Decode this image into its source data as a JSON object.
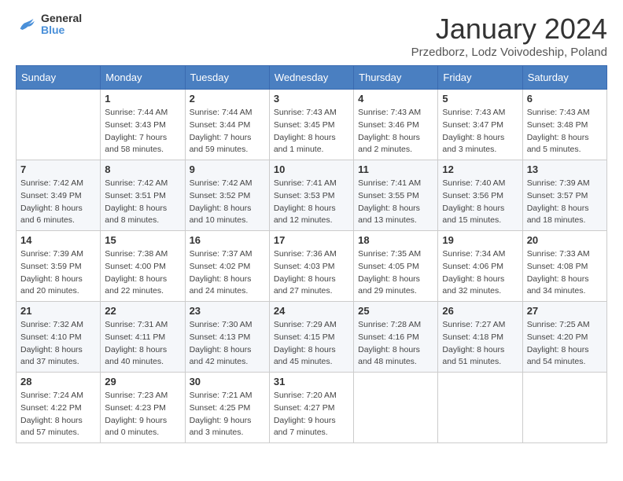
{
  "header": {
    "logo_general": "General",
    "logo_blue": "Blue",
    "month_title": "January 2024",
    "location": "Przedborz, Lodz Voivodeship, Poland"
  },
  "weekdays": [
    "Sunday",
    "Monday",
    "Tuesday",
    "Wednesday",
    "Thursday",
    "Friday",
    "Saturday"
  ],
  "weeks": [
    [
      {
        "day": "",
        "sunrise": "",
        "sunset": "",
        "daylight": ""
      },
      {
        "day": "1",
        "sunrise": "Sunrise: 7:44 AM",
        "sunset": "Sunset: 3:43 PM",
        "daylight": "Daylight: 7 hours and 58 minutes."
      },
      {
        "day": "2",
        "sunrise": "Sunrise: 7:44 AM",
        "sunset": "Sunset: 3:44 PM",
        "daylight": "Daylight: 7 hours and 59 minutes."
      },
      {
        "day": "3",
        "sunrise": "Sunrise: 7:43 AM",
        "sunset": "Sunset: 3:45 PM",
        "daylight": "Daylight: 8 hours and 1 minute."
      },
      {
        "day": "4",
        "sunrise": "Sunrise: 7:43 AM",
        "sunset": "Sunset: 3:46 PM",
        "daylight": "Daylight: 8 hours and 2 minutes."
      },
      {
        "day": "5",
        "sunrise": "Sunrise: 7:43 AM",
        "sunset": "Sunset: 3:47 PM",
        "daylight": "Daylight: 8 hours and 3 minutes."
      },
      {
        "day": "6",
        "sunrise": "Sunrise: 7:43 AM",
        "sunset": "Sunset: 3:48 PM",
        "daylight": "Daylight: 8 hours and 5 minutes."
      }
    ],
    [
      {
        "day": "7",
        "sunrise": "Sunrise: 7:42 AM",
        "sunset": "Sunset: 3:49 PM",
        "daylight": "Daylight: 8 hours and 6 minutes."
      },
      {
        "day": "8",
        "sunrise": "Sunrise: 7:42 AM",
        "sunset": "Sunset: 3:51 PM",
        "daylight": "Daylight: 8 hours and 8 minutes."
      },
      {
        "day": "9",
        "sunrise": "Sunrise: 7:42 AM",
        "sunset": "Sunset: 3:52 PM",
        "daylight": "Daylight: 8 hours and 10 minutes."
      },
      {
        "day": "10",
        "sunrise": "Sunrise: 7:41 AM",
        "sunset": "Sunset: 3:53 PM",
        "daylight": "Daylight: 8 hours and 12 minutes."
      },
      {
        "day": "11",
        "sunrise": "Sunrise: 7:41 AM",
        "sunset": "Sunset: 3:55 PM",
        "daylight": "Daylight: 8 hours and 13 minutes."
      },
      {
        "day": "12",
        "sunrise": "Sunrise: 7:40 AM",
        "sunset": "Sunset: 3:56 PM",
        "daylight": "Daylight: 8 hours and 15 minutes."
      },
      {
        "day": "13",
        "sunrise": "Sunrise: 7:39 AM",
        "sunset": "Sunset: 3:57 PM",
        "daylight": "Daylight: 8 hours and 18 minutes."
      }
    ],
    [
      {
        "day": "14",
        "sunrise": "Sunrise: 7:39 AM",
        "sunset": "Sunset: 3:59 PM",
        "daylight": "Daylight: 8 hours and 20 minutes."
      },
      {
        "day": "15",
        "sunrise": "Sunrise: 7:38 AM",
        "sunset": "Sunset: 4:00 PM",
        "daylight": "Daylight: 8 hours and 22 minutes."
      },
      {
        "day": "16",
        "sunrise": "Sunrise: 7:37 AM",
        "sunset": "Sunset: 4:02 PM",
        "daylight": "Daylight: 8 hours and 24 minutes."
      },
      {
        "day": "17",
        "sunrise": "Sunrise: 7:36 AM",
        "sunset": "Sunset: 4:03 PM",
        "daylight": "Daylight: 8 hours and 27 minutes."
      },
      {
        "day": "18",
        "sunrise": "Sunrise: 7:35 AM",
        "sunset": "Sunset: 4:05 PM",
        "daylight": "Daylight: 8 hours and 29 minutes."
      },
      {
        "day": "19",
        "sunrise": "Sunrise: 7:34 AM",
        "sunset": "Sunset: 4:06 PM",
        "daylight": "Daylight: 8 hours and 32 minutes."
      },
      {
        "day": "20",
        "sunrise": "Sunrise: 7:33 AM",
        "sunset": "Sunset: 4:08 PM",
        "daylight": "Daylight: 8 hours and 34 minutes."
      }
    ],
    [
      {
        "day": "21",
        "sunrise": "Sunrise: 7:32 AM",
        "sunset": "Sunset: 4:10 PM",
        "daylight": "Daylight: 8 hours and 37 minutes."
      },
      {
        "day": "22",
        "sunrise": "Sunrise: 7:31 AM",
        "sunset": "Sunset: 4:11 PM",
        "daylight": "Daylight: 8 hours and 40 minutes."
      },
      {
        "day": "23",
        "sunrise": "Sunrise: 7:30 AM",
        "sunset": "Sunset: 4:13 PM",
        "daylight": "Daylight: 8 hours and 42 minutes."
      },
      {
        "day": "24",
        "sunrise": "Sunrise: 7:29 AM",
        "sunset": "Sunset: 4:15 PM",
        "daylight": "Daylight: 8 hours and 45 minutes."
      },
      {
        "day": "25",
        "sunrise": "Sunrise: 7:28 AM",
        "sunset": "Sunset: 4:16 PM",
        "daylight": "Daylight: 8 hours and 48 minutes."
      },
      {
        "day": "26",
        "sunrise": "Sunrise: 7:27 AM",
        "sunset": "Sunset: 4:18 PM",
        "daylight": "Daylight: 8 hours and 51 minutes."
      },
      {
        "day": "27",
        "sunrise": "Sunrise: 7:25 AM",
        "sunset": "Sunset: 4:20 PM",
        "daylight": "Daylight: 8 hours and 54 minutes."
      }
    ],
    [
      {
        "day": "28",
        "sunrise": "Sunrise: 7:24 AM",
        "sunset": "Sunset: 4:22 PM",
        "daylight": "Daylight: 8 hours and 57 minutes."
      },
      {
        "day": "29",
        "sunrise": "Sunrise: 7:23 AM",
        "sunset": "Sunset: 4:23 PM",
        "daylight": "Daylight: 9 hours and 0 minutes."
      },
      {
        "day": "30",
        "sunrise": "Sunrise: 7:21 AM",
        "sunset": "Sunset: 4:25 PM",
        "daylight": "Daylight: 9 hours and 3 minutes."
      },
      {
        "day": "31",
        "sunrise": "Sunrise: 7:20 AM",
        "sunset": "Sunset: 4:27 PM",
        "daylight": "Daylight: 9 hours and 7 minutes."
      },
      {
        "day": "",
        "sunrise": "",
        "sunset": "",
        "daylight": ""
      },
      {
        "day": "",
        "sunrise": "",
        "sunset": "",
        "daylight": ""
      },
      {
        "day": "",
        "sunrise": "",
        "sunset": "",
        "daylight": ""
      }
    ]
  ]
}
